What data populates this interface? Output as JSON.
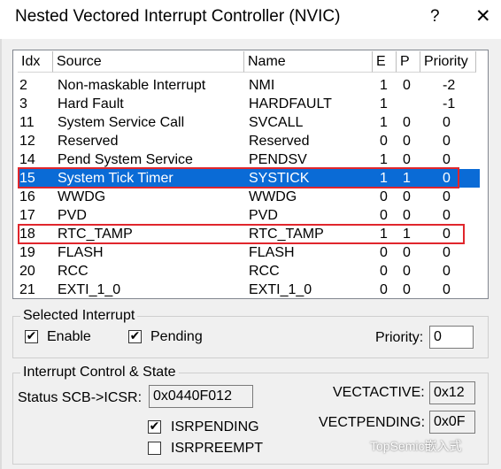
{
  "window": {
    "title": "Nested Vectored Interrupt Controller (NVIC)",
    "help": "?",
    "close": "✕"
  },
  "table": {
    "columns": [
      "Idx",
      "Source",
      "Name",
      "E",
      "P",
      "Priority"
    ],
    "rows": [
      {
        "idx": "2",
        "source": "Non-maskable Interrupt",
        "name": "NMI",
        "e": "1",
        "p": "0",
        "priority": "-2"
      },
      {
        "idx": "3",
        "source": "Hard Fault",
        "name": "HARDFAULT",
        "e": "1",
        "p": "",
        "priority": "-1"
      },
      {
        "idx": "11",
        "source": "System Service Call",
        "name": "SVCALL",
        "e": "1",
        "p": "0",
        "priority": "0"
      },
      {
        "idx": "12",
        "source": "Reserved",
        "name": "Reserved",
        "e": "0",
        "p": "0",
        "priority": "0"
      },
      {
        "idx": "14",
        "source": "Pend System Service",
        "name": "PENDSV",
        "e": "1",
        "p": "0",
        "priority": "0"
      },
      {
        "idx": "15",
        "source": "System Tick Timer",
        "name": "SYSTICK",
        "e": "1",
        "p": "1",
        "priority": "0",
        "selected": true
      },
      {
        "idx": "16",
        "source": "WWDG",
        "name": "WWDG",
        "e": "0",
        "p": "0",
        "priority": "0"
      },
      {
        "idx": "17",
        "source": "PVD",
        "name": "PVD",
        "e": "0",
        "p": "0",
        "priority": "0"
      },
      {
        "idx": "18",
        "source": "RTC_TAMP",
        "name": "RTC_TAMP",
        "e": "1",
        "p": "1",
        "priority": "0"
      },
      {
        "idx": "19",
        "source": "FLASH",
        "name": "FLASH",
        "e": "0",
        "p": "0",
        "priority": "0"
      },
      {
        "idx": "20",
        "source": "RCC",
        "name": "RCC",
        "e": "0",
        "p": "0",
        "priority": "0"
      },
      {
        "idx": "21",
        "source": "EXTI_1_0",
        "name": "EXTI_1_0",
        "e": "0",
        "p": "0",
        "priority": "0"
      }
    ]
  },
  "selected_interrupt": {
    "legend": "Selected Interrupt",
    "enable_label": "Enable",
    "enable_checked": true,
    "pending_label": "Pending",
    "pending_checked": true,
    "priority_label": "Priority:",
    "priority_value": "0"
  },
  "control_state": {
    "legend": "Interrupt Control & State",
    "status_label": "Status  SCB->ICSR:",
    "status_value": "0x0440F012",
    "isrpending_label": "ISRPENDING",
    "isrpending_checked": true,
    "isrpreempt_label": "ISRPREEMPT",
    "isrpreempt_checked": false,
    "vectactive_label": "VECTACTIVE:",
    "vectactive_value": "0x12",
    "vectpending_label": "VECTPENDING:",
    "vectpending_value": "0x0F"
  },
  "watermark": "TopSemic嵌入式",
  "colors": {
    "selection": "#0a6bd6",
    "highlight_box": "#e0262c"
  }
}
